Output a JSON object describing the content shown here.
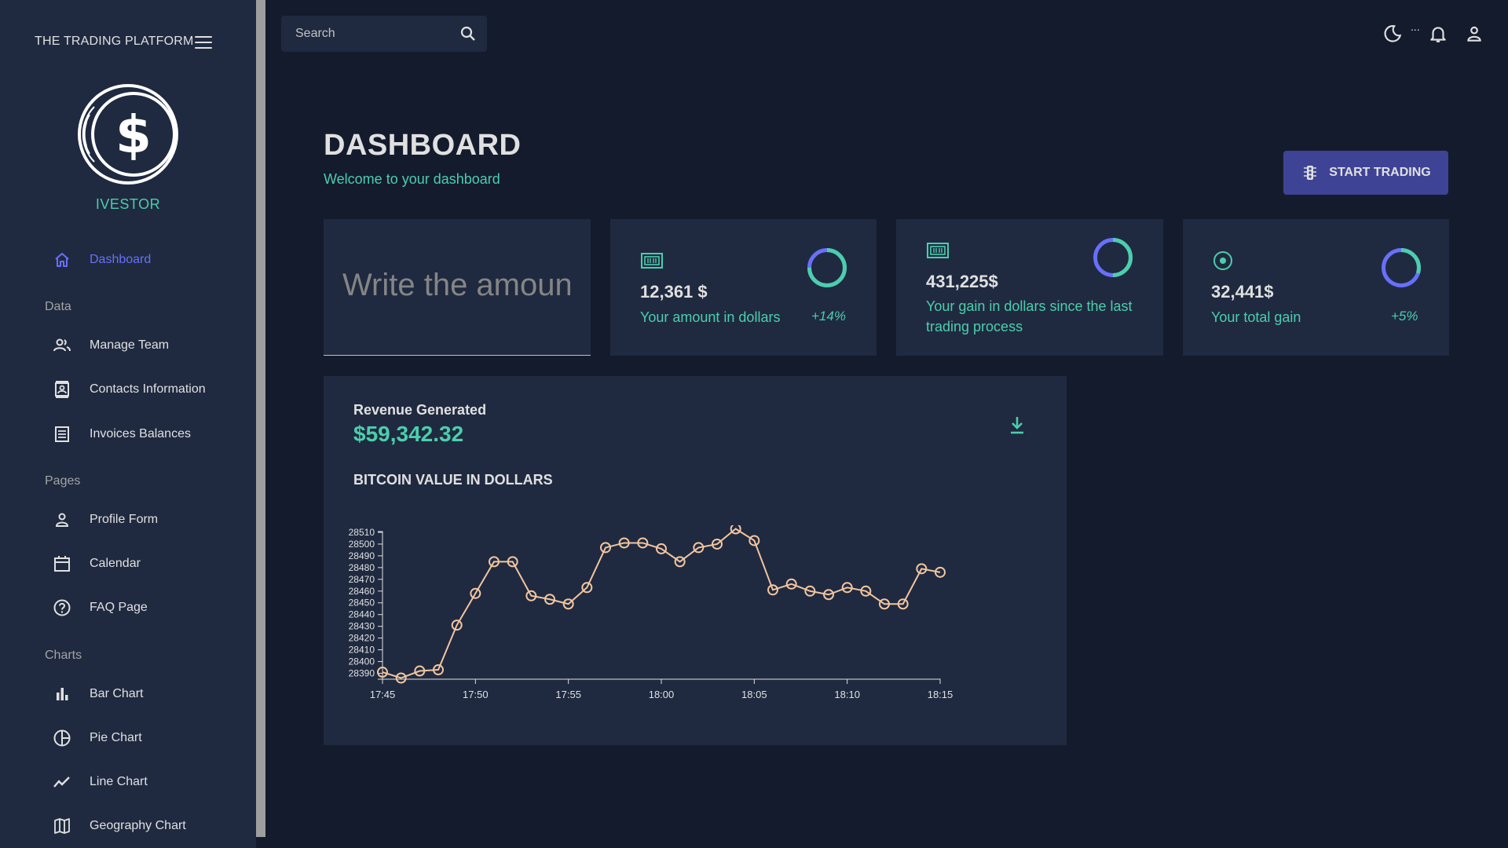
{
  "app": {
    "brand": "THE TRADING PLATFORM",
    "logo_name": "IVESTOR"
  },
  "sidebar": {
    "items": [
      {
        "label": "Dashboard",
        "icon": "home-icon",
        "active": true
      },
      {
        "label": "Manage Team",
        "icon": "people-icon"
      },
      {
        "label": "Contacts Information",
        "icon": "contacts-icon"
      },
      {
        "label": "Invoices Balances",
        "icon": "receipt-icon"
      },
      {
        "label": "Profile Form",
        "icon": "person-icon"
      },
      {
        "label": "Calendar",
        "icon": "calendar-icon"
      },
      {
        "label": "FAQ Page",
        "icon": "help-icon"
      },
      {
        "label": "Bar Chart",
        "icon": "bar-chart-icon"
      },
      {
        "label": "Pie Chart",
        "icon": "pie-chart-icon"
      },
      {
        "label": "Line Chart",
        "icon": "line-chart-icon"
      },
      {
        "label": "Geography Chart",
        "icon": "map-icon"
      }
    ],
    "sections": {
      "data": "Data",
      "pages": "Pages",
      "charts": "Charts"
    }
  },
  "topbar": {
    "search_placeholder": "Search",
    "dots": "..."
  },
  "header": {
    "title": "DASHBOARD",
    "subtitle": "Welcome to your dashboard",
    "start_button": "START TRADING"
  },
  "stats": {
    "amount_placeholder": "Write the amount",
    "card1": {
      "value": "12,361 $",
      "label": "Your amount in dollars",
      "pct": "+14%",
      "progress": 0.75
    },
    "card2": {
      "value": "431,225$",
      "label": "Your gain in dollars since the last trading process",
      "progress": 0.5
    },
    "card3": {
      "value": "32,441$",
      "label": "Your total gain",
      "pct": "+5%",
      "progress": 0.3
    }
  },
  "colors": {
    "accent_green": "#4cceac",
    "accent_blue": "#6870fa",
    "button": "#3e4396",
    "panel": "#1f2a40",
    "background": "#141b2d",
    "line": "#f2c5a0"
  },
  "revenue": {
    "title": "Revenue Generated",
    "value": "$59,342.32"
  },
  "chart_data": {
    "type": "line",
    "title": "BITCOIN VALUE IN DOLLARS",
    "xlabel": "",
    "ylabel": "",
    "x_ticks": [
      "17:45",
      "17:50",
      "17:55",
      "18:00",
      "18:05",
      "18:10",
      "18:15"
    ],
    "y_ticks": [
      28390,
      28400,
      28410,
      28420,
      28430,
      28440,
      28450,
      28460,
      28470,
      28480,
      28490,
      28500,
      28510
    ],
    "ylim": [
      28385,
      28516
    ],
    "x_minutes_range": [
      0,
      30
    ],
    "series": [
      {
        "x": [
          "17:45",
          "17:46",
          "17:47",
          "17:48",
          "17:49",
          "17:50",
          "17:51",
          "17:52",
          "17:53",
          "17:54",
          "17:55",
          "17:56",
          "17:57",
          "17:58",
          "17:59",
          "18:00",
          "18:01",
          "18:02",
          "18:03",
          "18:04",
          "18:05",
          "18:06",
          "18:07",
          "18:08",
          "18:09",
          "18:10",
          "18:11",
          "18:12",
          "18:13",
          "18:14",
          "18:15"
        ],
        "values": [
          28391,
          28386,
          28392,
          28393,
          28431,
          28458,
          28485,
          28485,
          28456,
          28453,
          28449,
          28463,
          28497,
          28501,
          28501,
          28496,
          28485,
          28497,
          28500,
          28513,
          28503,
          28461,
          28466,
          28460,
          28457,
          28463,
          28460,
          28449,
          28449,
          28479,
          28476
        ]
      }
    ]
  }
}
